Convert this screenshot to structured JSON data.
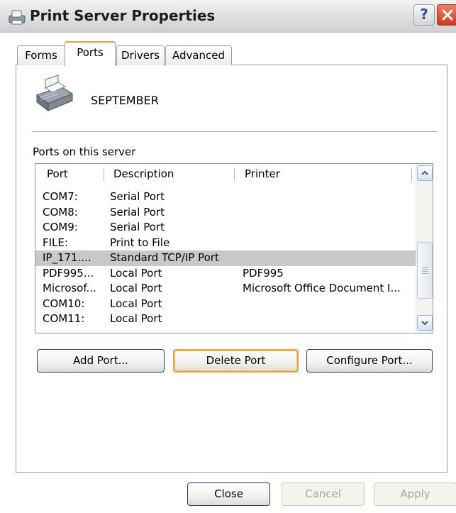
{
  "window": {
    "title": "Print Server Properties",
    "help_label": "?"
  },
  "tabs": [
    {
      "label": "Forms"
    },
    {
      "label": "Ports"
    },
    {
      "label": "Drivers"
    },
    {
      "label": "Advanced"
    }
  ],
  "active_tab": "Ports",
  "server": {
    "name": "SEPTEMBER"
  },
  "ports_section": {
    "label": "Ports on this server"
  },
  "list": {
    "columns": [
      "Port",
      "Description",
      "Printer"
    ],
    "rows": [
      {
        "port": "COM7:",
        "description": "Serial Port",
        "printer": ""
      },
      {
        "port": "COM8:",
        "description": "Serial Port",
        "printer": ""
      },
      {
        "port": "COM9:",
        "description": "Serial Port",
        "printer": ""
      },
      {
        "port": "FILE:",
        "description": "Print to File",
        "printer": ""
      },
      {
        "port": "IP_171....",
        "description": "Standard TCP/IP Port",
        "printer": ""
      },
      {
        "port": "PDF995...",
        "description": "Local Port",
        "printer": "PDF995"
      },
      {
        "port": "Microsof...",
        "description": "Local Port",
        "printer": "Microsoft Office Document I..."
      },
      {
        "port": "COM10:",
        "description": "Local Port",
        "printer": ""
      },
      {
        "port": "COM11:",
        "description": "Local Port",
        "printer": ""
      }
    ],
    "selected_row": 4
  },
  "port_buttons": {
    "add": "Add Port...",
    "delete": "Delete Port",
    "configure": "Configure Port..."
  },
  "dialog_buttons": {
    "close": "Close",
    "cancel": "Cancel",
    "apply": "Apply"
  },
  "colors": {
    "selection": "#c8c8c8",
    "focus_accent": "#e8a33b",
    "close_button": "#c83a1e"
  },
  "icons": {
    "title": "printer-server-icon",
    "server": "printer-icon",
    "close": "close-icon",
    "scroll_up": "chevron-up-icon",
    "scroll_down": "chevron-down-icon"
  }
}
